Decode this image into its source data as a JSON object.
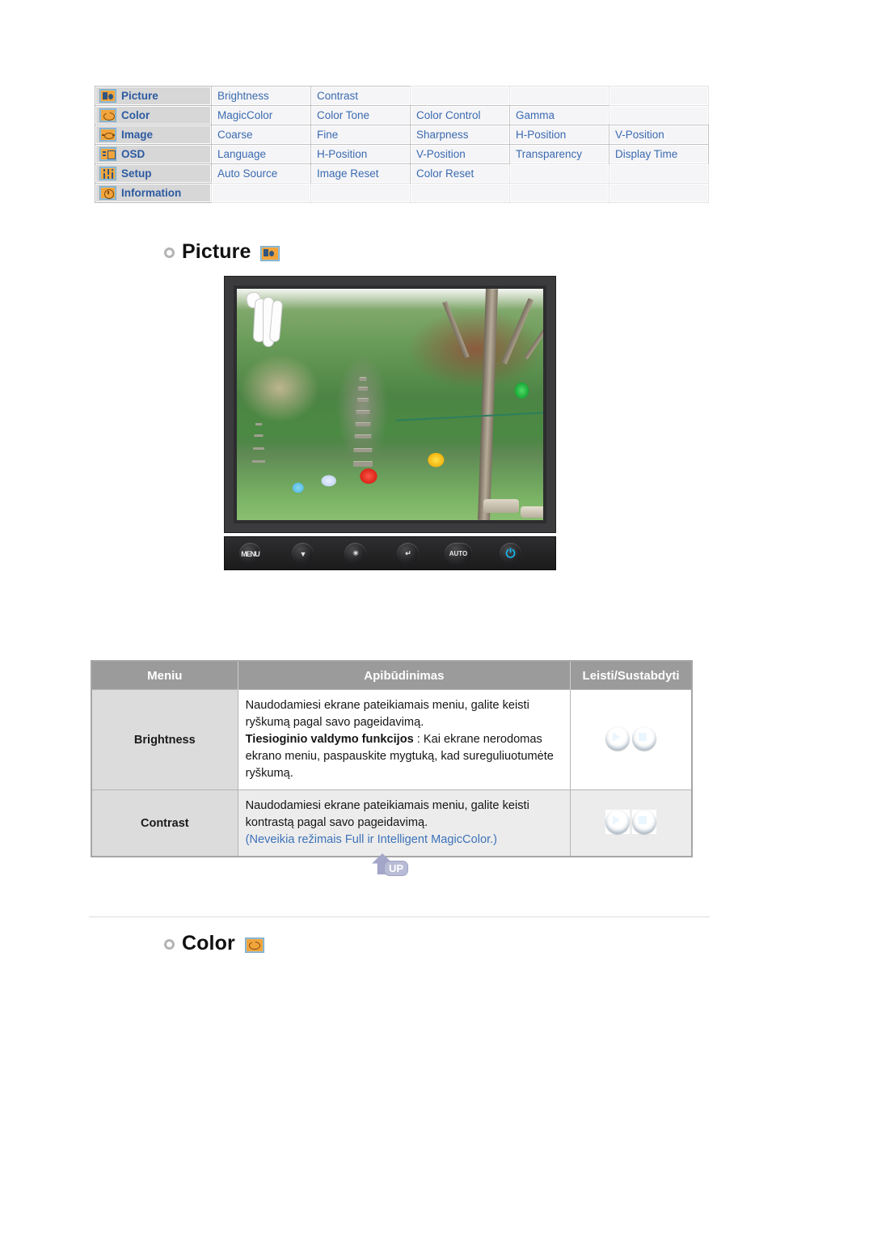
{
  "osd_nav": {
    "rows": [
      {
        "category": "Picture",
        "icon": "picture-icon",
        "items": [
          "Brightness",
          "Contrast",
          "",
          "",
          ""
        ]
      },
      {
        "category": "Color",
        "icon": "color-icon",
        "items": [
          "MagicColor",
          "Color Tone",
          "Color Control",
          "Gamma",
          ""
        ]
      },
      {
        "category": "Image",
        "icon": "image-icon",
        "items": [
          "Coarse",
          "Fine",
          "Sharpness",
          "H-Position",
          "V-Position"
        ]
      },
      {
        "category": "OSD",
        "icon": "osd-icon",
        "items": [
          "Language",
          "H-Position",
          "V-Position",
          "Transparency",
          "Display Time"
        ]
      },
      {
        "category": "Setup",
        "icon": "setup-icon",
        "items": [
          "Auto Source",
          "Image Reset",
          "Color Reset",
          "",
          ""
        ]
      },
      {
        "category": "Information",
        "icon": "information-icon",
        "items": [
          "",
          "",
          "",
          "",
          ""
        ]
      }
    ]
  },
  "sections": {
    "picture": {
      "title": "Picture",
      "icon": "picture-icon"
    },
    "color": {
      "title": "Color",
      "icon": "color-icon"
    }
  },
  "monitor": {
    "buttons": [
      {
        "name": "menu-button",
        "label": "MENU"
      },
      {
        "name": "down-adjust-button",
        "label": "▼"
      },
      {
        "name": "brightness-button",
        "label": "☀"
      },
      {
        "name": "enter-button",
        "label": "↵"
      },
      {
        "name": "auto-button",
        "label": "AUTO"
      },
      {
        "name": "power-button",
        "label": "⏻"
      }
    ]
  },
  "desc_table": {
    "headers": [
      "Meniu",
      "Apibūdinimas",
      "Leisti/Sustabdyti"
    ],
    "rows": [
      {
        "menu": "Brightness",
        "desc_line1": "Naudodamiesi ekrane pateikiamais meniu, galite keisti ryškumą pagal savo pageidavimą.",
        "desc_bold": "Tiesioginio valdymo funkcijos",
        "desc_line2": " : Kai ekrane nerodomas ekrano meniu, paspauskite mygtuką, kad sureguliuotumėte ryškumą.",
        "desc_note": "",
        "controls": [
          "play-icon",
          "stop-icon"
        ]
      },
      {
        "menu": "Contrast",
        "desc_line1": "Naudodamiesi ekrane pateikiamais meniu, galite keisti kontrastą pagal savo pageidavimą.",
        "desc_bold": "",
        "desc_line2": "",
        "desc_note": "(Neveikia režimais Full ir Intelligent MagicColor.)",
        "controls": [
          "play-icon",
          "stop-icon"
        ]
      }
    ]
  },
  "up_button": {
    "label": "UP"
  },
  "colors": {
    "nav_link": "#3b6ab0",
    "nav_category": "#2c5aa0",
    "table_header_bg": "#9b9b9b",
    "menu_cell_bg": "#dcdcdc",
    "note_blue": "#3d72b8",
    "icon_orange": "#f2a43a"
  }
}
